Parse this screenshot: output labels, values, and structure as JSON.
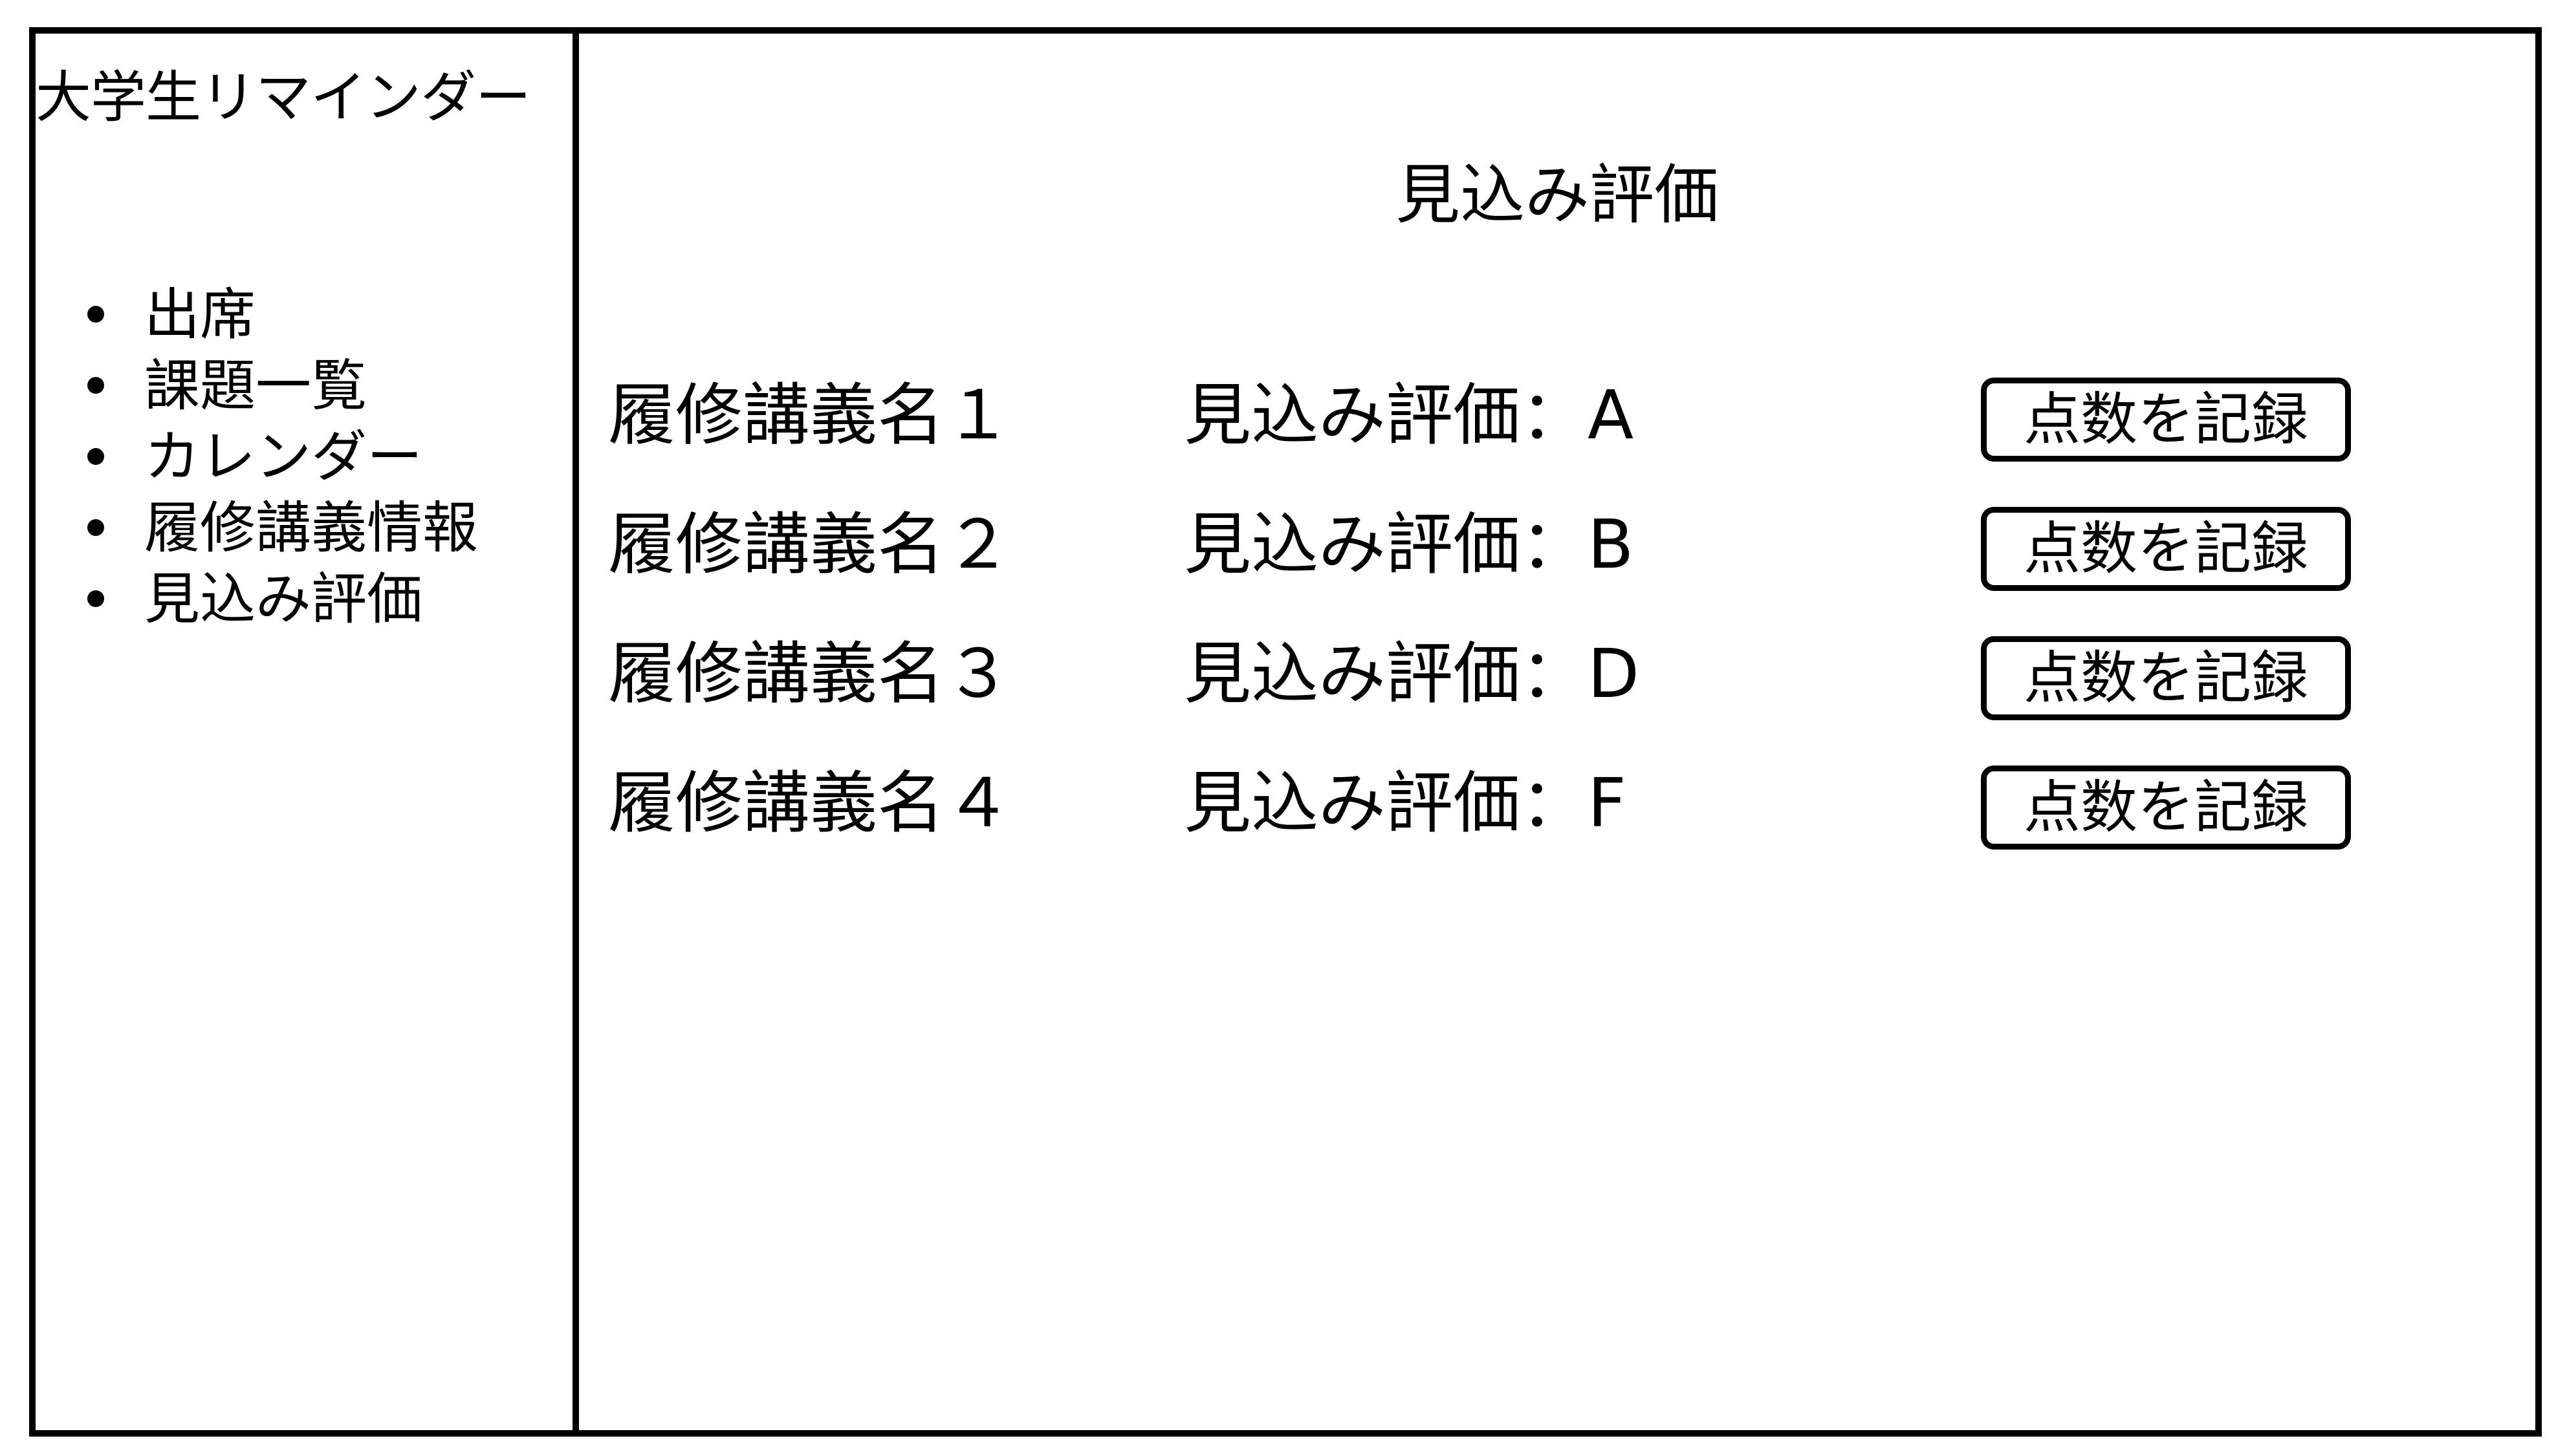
{
  "sidebar": {
    "app_title": "大学生リマインダー",
    "items": [
      {
        "label": "出席"
      },
      {
        "label": "課題一覧"
      },
      {
        "label": "カレンダー"
      },
      {
        "label": "履修講義情報"
      },
      {
        "label": "見込み評価"
      }
    ]
  },
  "main": {
    "title": "見込み評価",
    "courses": [
      {
        "name": "履修講義名１",
        "evaluation": "見込み評価：A",
        "button_label": "点数を記録"
      },
      {
        "name": "履修講義名２",
        "evaluation": "見込み評価：B",
        "button_label": "点数を記録"
      },
      {
        "name": "履修講義名３",
        "evaluation": "見込み評価：D",
        "button_label": "点数を記録"
      },
      {
        "name": "履修講義名４",
        "evaluation": "見込み評価：F",
        "button_label": "点数を記録"
      }
    ]
  },
  "colors": {
    "border": "#000000",
    "background": "#ffffff",
    "text": "#000000"
  }
}
